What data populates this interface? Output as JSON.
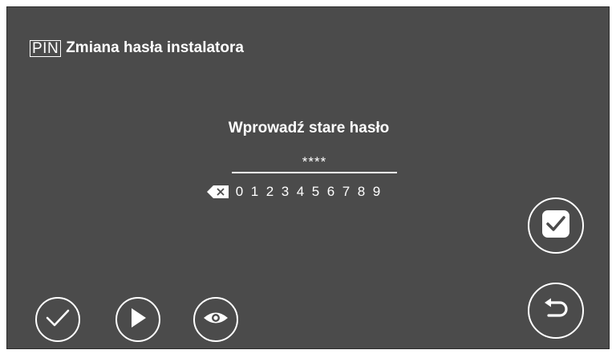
{
  "header": {
    "pin_badge": "PIN",
    "title": "Zmiana hasła instalatora"
  },
  "prompt": "Wprowadź stare hasło",
  "password_mask": "****",
  "keypad": {
    "backspace_icon": "backspace-x-icon",
    "digits": [
      "0",
      "1",
      "2",
      "3",
      "4",
      "5",
      "6",
      "7",
      "8",
      "9"
    ]
  },
  "buttons": {
    "confirm": "checkbox-check-icon",
    "return": "return-arrow-icon",
    "check": "check-icon",
    "play": "play-icon",
    "eye": "eye-icon"
  },
  "colors": {
    "background": "#4b4b4b",
    "foreground": "#ffffff"
  }
}
